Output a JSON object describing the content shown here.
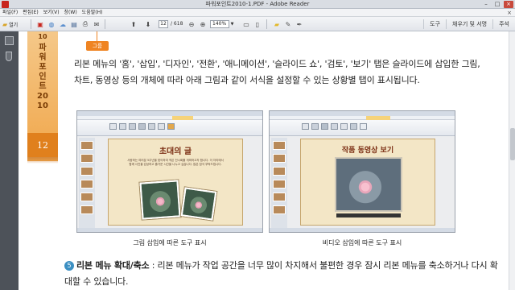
{
  "window": {
    "title": "파워포인트2010-1.PDF - Adobe Reader"
  },
  "menu": {
    "items": [
      "파일(F)",
      "편집(E)",
      "보기(V)",
      "창(W)",
      "도움말(H)"
    ]
  },
  "toolbar": {
    "open_label": "열기",
    "page_current": "12",
    "page_total": "/ 618",
    "zoom": "140%",
    "right_tools": [
      "도구",
      "채우기 및 서명",
      "주석"
    ]
  },
  "chapter": {
    "number": "10",
    "title": "파워포인트2010",
    "page": "12"
  },
  "body": {
    "group_badge": "그룹",
    "paragraph": "리본 메뉴의 '홈', '삽입', '디자인', '전환', '애니메이션', '슬라이드 쇼', '검토', '보기' 탭은 슬라이드에 삽입한 그림, 차트, 동영상 등의 개체에 따라 아래 그림과 같이 서식을 설정할 수 있는 상황별 탭이 표시됩니다.",
    "caption_left": "그림 삽입에 따른 도구 표시",
    "caption_right": "비디오 삽입에 따른 도구 표시",
    "item_number": "5",
    "item_title": "리본 메뉴 확대/축소",
    "item_text": " : 리본 메뉴가 작업 공간을 너무 많이 차지해서 불편한 경우 잠시 리본 메뉴를 축소하거나 다시 확대할 수 있습니다."
  },
  "screens": {
    "left": {
      "slide_title": "초대의 글",
      "slide_text": "사랑하는 여러분 5주년을 맞이하여 작은 전시회를 개최하고자 합니다. 이 자리에서 함께 사진을 감상하고 즐거운 시간을 나누고 싶습니다. 많은 참석 부탁드립니다."
    },
    "right": {
      "slide_title": "작품 동영상 보기"
    }
  },
  "colors": {
    "accent_orange": "#ef8422",
    "chapter_tab": "#e0801d",
    "nav_panel": "#4d5259"
  },
  "icons": {
    "toolbar": [
      "open-folder-icon",
      "create-pdf-icon",
      "save-icon",
      "print-icon",
      "email-icon",
      "prev-page-icon",
      "next-page-icon",
      "zoom-out-icon",
      "zoom-in-icon",
      "page-view-icon",
      "comment-icon",
      "highlight-icon",
      "sign-icon"
    ],
    "nav": [
      "pages-panel-icon",
      "attachments-icon"
    ]
  }
}
